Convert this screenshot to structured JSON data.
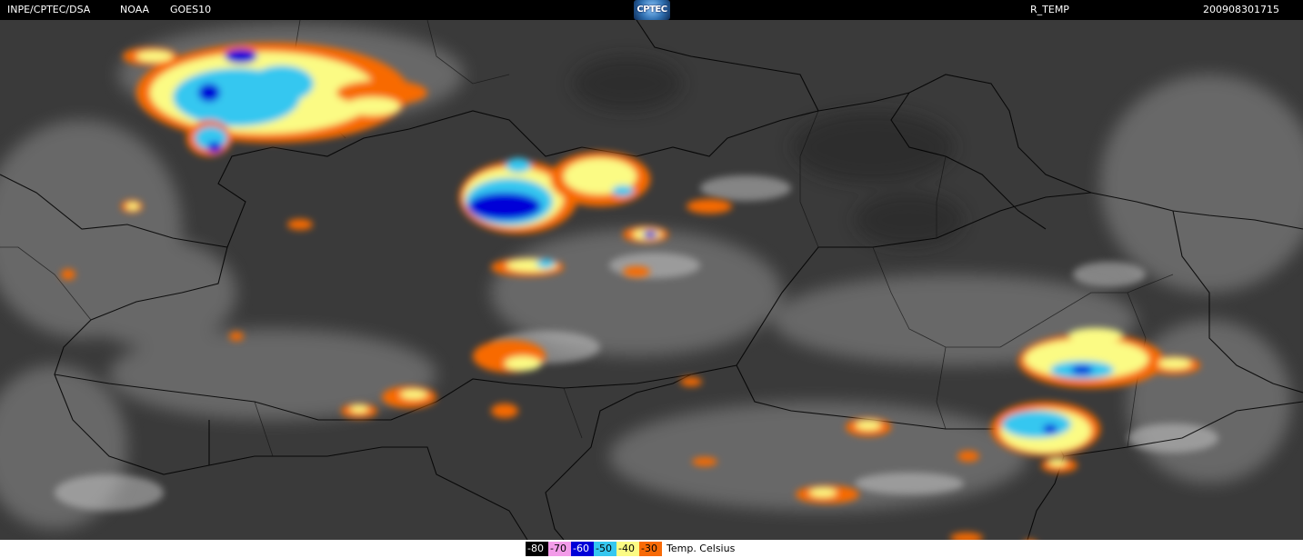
{
  "header": {
    "source": "INPE/CPTEC/DSA",
    "agency": "NOAA",
    "satellite": "GOES10",
    "logo_text": "CPTEC",
    "product": "R_TEMP",
    "timestamp": "200908301715"
  },
  "legend": {
    "unit_label": "Temp. Celsius",
    "items": [
      {
        "label": "-80",
        "color": "#000000",
        "text_color": "#ffffff"
      },
      {
        "label": "-70",
        "color": "#f39ce9",
        "text_color": "#000000"
      },
      {
        "label": "-60",
        "color": "#0000d8",
        "text_color": "#ffffff"
      },
      {
        "label": "-50",
        "color": "#35c7f0",
        "text_color": "#000000"
      },
      {
        "label": "-40",
        "color": "#fbfb84",
        "text_color": "#000000"
      },
      {
        "label": "-30",
        "color": "#f86a06",
        "text_color": "#000000"
      }
    ]
  },
  "colors": {
    "background": "#3a3a3a",
    "border_lines": "#000000",
    "cloud_gray": "#bdbdbd"
  },
  "map": {
    "type": "satellite infrared enhanced cloud-top temperature",
    "region": "South America",
    "features": [
      "country borders",
      "state borders",
      "convective cloud clusters"
    ]
  }
}
